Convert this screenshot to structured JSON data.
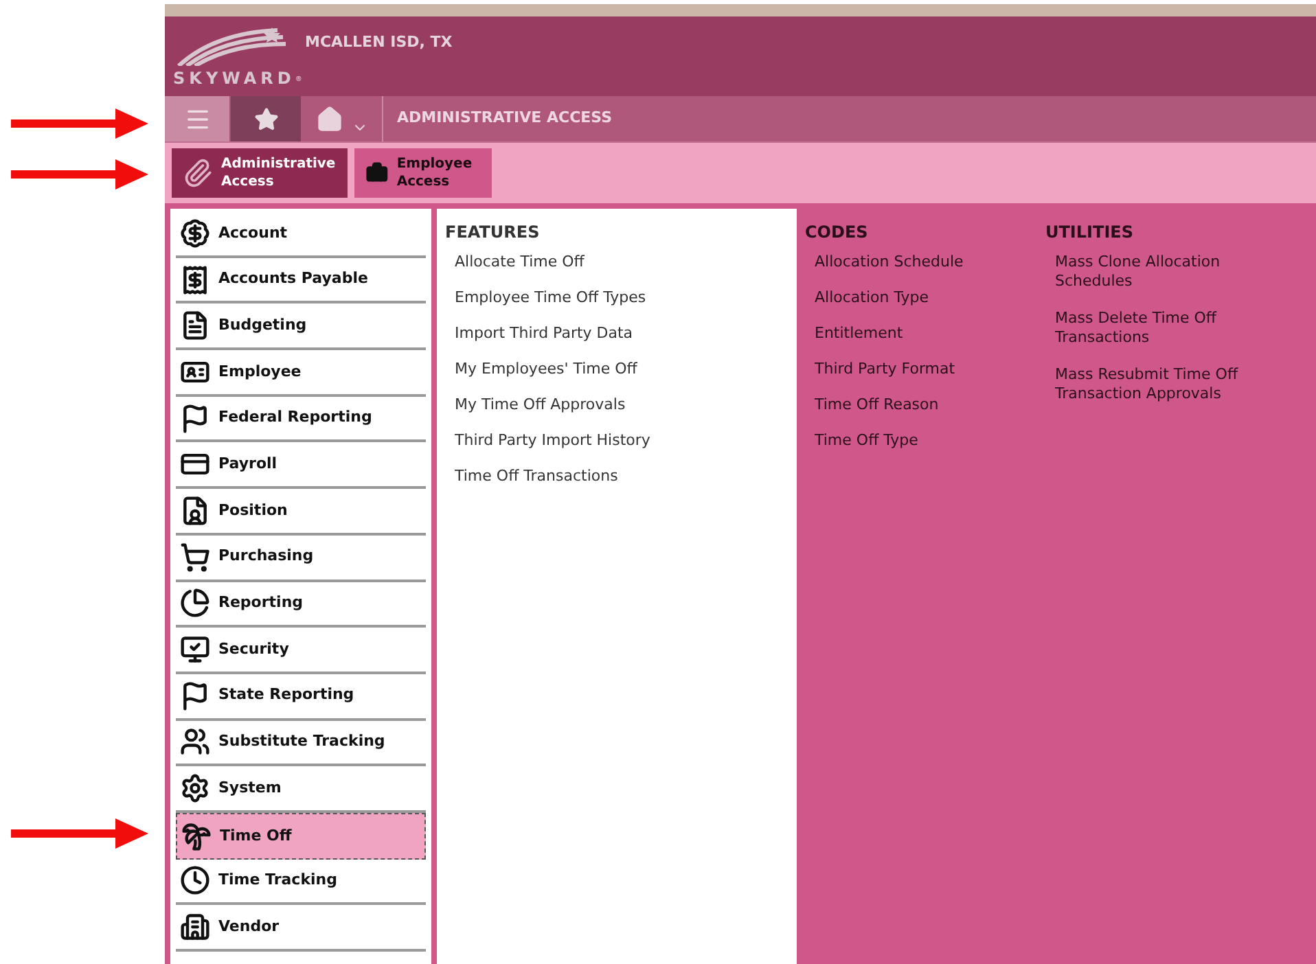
{
  "header": {
    "district": "MCALLEN ISD, TX",
    "logo_text": "SKYWARD",
    "logo_mark": "®"
  },
  "nav_bar": {
    "title": "ADMINISTRATIVE ACCESS"
  },
  "access_tabs": [
    {
      "label": "Administrative Access",
      "selected": true
    },
    {
      "label": "Employee Access",
      "selected": false
    }
  ],
  "sidebar": {
    "items": [
      {
        "label": "Account",
        "selected": false
      },
      {
        "label": "Accounts Payable",
        "selected": false
      },
      {
        "label": "Budgeting",
        "selected": false
      },
      {
        "label": "Employee",
        "selected": false
      },
      {
        "label": "Federal Reporting",
        "selected": false
      },
      {
        "label": "Payroll",
        "selected": false
      },
      {
        "label": "Position",
        "selected": false
      },
      {
        "label": "Purchasing",
        "selected": false
      },
      {
        "label": "Reporting",
        "selected": false
      },
      {
        "label": "Security",
        "selected": false
      },
      {
        "label": "State Reporting",
        "selected": false
      },
      {
        "label": "Substitute Tracking",
        "selected": false
      },
      {
        "label": "System",
        "selected": false
      },
      {
        "label": "Time Off",
        "selected": true
      },
      {
        "label": "Time Tracking",
        "selected": false
      },
      {
        "label": "Vendor",
        "selected": false
      }
    ]
  },
  "features": {
    "heading": "FEATURES",
    "links": [
      "Allocate Time Off",
      "Employee Time Off Types",
      "Import Third Party Data",
      "My Employees' Time Off",
      "My Time Off Approvals",
      "Third Party Import History",
      "Time Off Transactions"
    ]
  },
  "codes": {
    "heading": "CODES",
    "links": [
      "Allocation Schedule",
      "Allocation Type",
      "Entitlement",
      "Third Party Format",
      "Time Off Reason",
      "Time Off Type"
    ]
  },
  "utilities": {
    "heading": "UTILITIES",
    "links": [
      "Mass Clone Allocation Schedules",
      "Mass Delete Time Off Transactions",
      "Mass Resubmit Time Off Transaction Approvals"
    ]
  }
}
